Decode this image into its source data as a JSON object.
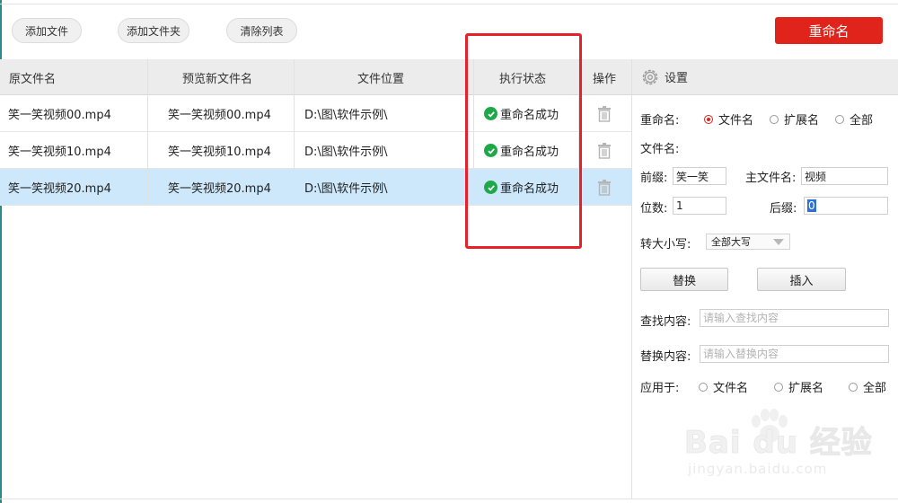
{
  "toolbar": {
    "add_file": "添加文件",
    "add_folder": "添加文件夹",
    "clear_list": "清除列表",
    "rename": "重命名"
  },
  "table": {
    "headers": [
      "原文件名",
      "预览新文件名",
      "文件位置",
      "执行状态",
      "操作"
    ],
    "rows": [
      {
        "original": "笑一笑视频00.mp4",
        "preview": "笑一笑视频00.mp4",
        "location": "D:\\图\\软件示例\\",
        "status": "重命名成功",
        "selected": false
      },
      {
        "original": "笑一笑视频10.mp4",
        "preview": "笑一笑视频10.mp4",
        "location": "D:\\图\\软件示例\\",
        "status": "重命名成功",
        "selected": false
      },
      {
        "original": "笑一笑视频20.mp4",
        "preview": "笑一笑视频20.mp4",
        "location": "D:\\图\\软件示例\\",
        "status": "重命名成功",
        "selected": true
      }
    ]
  },
  "settings": {
    "title": "设置",
    "rename_label": "重命名:",
    "rename_options": [
      "文件名",
      "扩展名",
      "全部"
    ],
    "rename_selected": "文件名",
    "filename_label": "文件名:",
    "prefix_label": "前缀:",
    "prefix_value": "笑一笑",
    "main_label": "主文件名:",
    "main_value": "视频",
    "digits_label": "位数:",
    "digits_value": "1",
    "suffix_label": "后缀:",
    "suffix_value": "0",
    "case_label": "转大小写:",
    "case_value": "全部大写",
    "replace_btn": "替换",
    "insert_btn": "插入",
    "find_label": "查找内容:",
    "find_placeholder": "请输入查找内容",
    "replace_label": "替换内容:",
    "replace_placeholder": "请输入替换内容",
    "apply_label": "应用于:",
    "apply_options": [
      "文件名",
      "扩展名",
      "全部"
    ]
  },
  "watermark": {
    "brand": "Bai du 经验",
    "url": "jingyan.baidu.com"
  },
  "colors": {
    "accent": "#e0241b",
    "selected_row": "#cce8fa",
    "success": "#1fa84a",
    "highlight": "#e8202a"
  }
}
